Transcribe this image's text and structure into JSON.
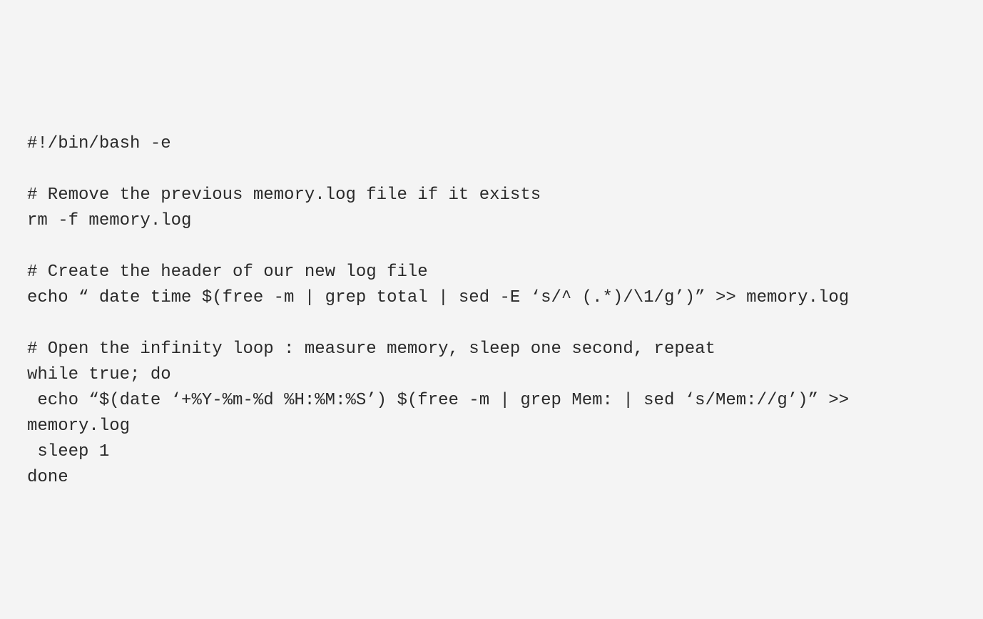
{
  "code": {
    "line1": "#!/bin/bash -e",
    "line2": "",
    "line3": "# Remove the previous memory.log file if it exists",
    "line4": "rm -f memory.log",
    "line5": "",
    "line6": "# Create the header of our new log file",
    "line7": "echo “ date time $(free -m | grep total | sed -E ‘s/^ (.*)/\\1/g’)” >> memory.log",
    "line8": "",
    "line9": "# Open the infinity loop : measure memory, sleep one second, repeat",
    "line10": "while true; do",
    "line11": " echo “$(date ‘+%Y-%m-%d %H:%M:%S’) $(free -m | grep Mem: | sed ‘s/Mem://g’)” >> memory.log",
    "line12": " sleep 1",
    "line13": "done"
  }
}
